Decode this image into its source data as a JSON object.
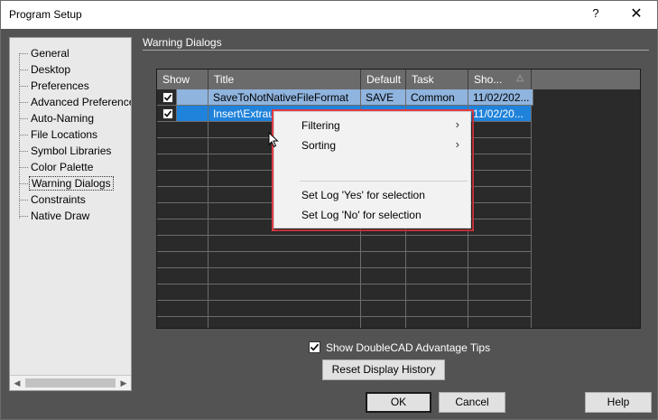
{
  "window": {
    "title": "Program Setup",
    "help_glyph": "?",
    "close_glyph": "✕"
  },
  "sidebar": {
    "items": [
      {
        "label": "General"
      },
      {
        "label": "Desktop"
      },
      {
        "label": "Preferences"
      },
      {
        "label": "Advanced Preferences"
      },
      {
        "label": "Auto-Naming"
      },
      {
        "label": "File Locations"
      },
      {
        "label": "Symbol Libraries"
      },
      {
        "label": "Color Palette"
      },
      {
        "label": "Warning Dialogs",
        "selected": true
      },
      {
        "label": "Constraints"
      },
      {
        "label": "Native Draw"
      }
    ]
  },
  "group": {
    "title": "Warning Dialogs"
  },
  "grid": {
    "columns": [
      "Show",
      "Title",
      "Default",
      "Task",
      "Sho..."
    ],
    "sorted_column": "Sho...",
    "rows": [
      {
        "show": true,
        "title": "SaveToNotNativeFileFormat",
        "default": "SAVE",
        "task": "Common",
        "shown": "11/02/202..."
      },
      {
        "show": true,
        "title": "Insert\\Extrau",
        "default": "",
        "task": "",
        "shown": "11/02/20..."
      }
    ]
  },
  "context_menu": {
    "items": [
      {
        "label": "Filtering",
        "submenu": true
      },
      {
        "label": "Sorting",
        "submenu": true
      },
      {
        "label": "Set Log 'Yes' for selection",
        "submenu": false
      },
      {
        "label": "Set Log 'No' for selection",
        "submenu": false
      }
    ],
    "submenu_glyph": "›",
    "highlight_color": "#e23b46"
  },
  "options": {
    "advantage_tips_label": "Show DoubleCAD Advantage Tips",
    "advantage_tips_checked": true,
    "reset_history_label": "Reset Display History"
  },
  "footer": {
    "ok_label": "OK",
    "cancel_label": "Cancel",
    "help_label": "Help"
  },
  "colors": {
    "selected_row_light": "#8fb4de",
    "selected_row_dark": "#1f82db",
    "dialog_bg": "#535353"
  }
}
